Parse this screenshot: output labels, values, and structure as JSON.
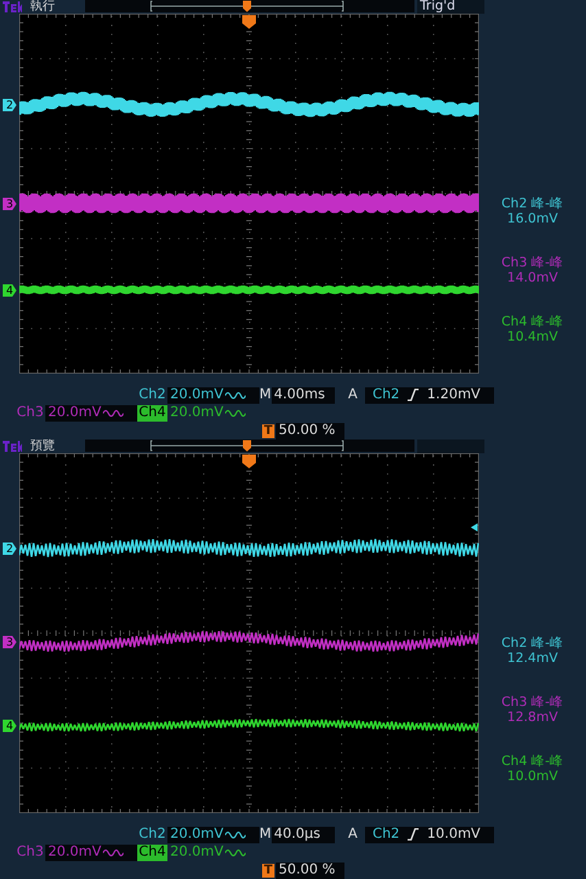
{
  "panels": [
    {
      "status": "執行",
      "trigger_state": "Trig'd",
      "trigger_level_marker": false,
      "channels": [
        {
          "label": "2",
          "color": "#3fd8e6"
        },
        {
          "label": "3",
          "color": "#c22fc4"
        },
        {
          "label": "4",
          "color": "#2fd62f"
        }
      ],
      "measurements": [
        {
          "label": "Ch2 峰-峰",
          "value": "16.0mV",
          "color": "#3fc4d2"
        },
        {
          "label": "Ch3 峰-峰",
          "value": "14.0mV",
          "color": "#b02cb8"
        },
        {
          "label": "Ch4 峰-峰",
          "value": "10.4mV",
          "color": "#2cbc2c"
        }
      ],
      "vertical": [
        {
          "channel": "Ch2",
          "scale": "20.0mV",
          "selected": false,
          "color": "#3fc4d2"
        },
        {
          "channel": "Ch3",
          "scale": "20.0mV",
          "selected": false,
          "color": "#b02cb8"
        },
        {
          "channel": "Ch4",
          "scale": "20.0mV",
          "selected": true,
          "color": "#2cbc2c"
        }
      ],
      "timebase": {
        "prefix": "M",
        "value": "4.00ms"
      },
      "trigger": {
        "mode": "A",
        "source": "Ch2",
        "value": "1.20mV"
      },
      "trigger_position": {
        "icon": "T",
        "value": "50.00 %"
      }
    },
    {
      "status": "預覽",
      "trigger_level_marker": true,
      "channels": [
        {
          "label": "2",
          "color": "#3fd8e6"
        },
        {
          "label": "3",
          "color": "#c22fc4"
        },
        {
          "label": "4",
          "color": "#2fd62f"
        }
      ],
      "measurements": [
        {
          "label": "Ch2 峰-峰",
          "value": "12.4mV",
          "color": "#3fc4d2"
        },
        {
          "label": "Ch3 峰-峰",
          "value": "12.8mV",
          "color": "#b02cb8"
        },
        {
          "label": "Ch4 峰-峰",
          "value": "10.0mV",
          "color": "#2cbc2c"
        }
      ],
      "vertical": [
        {
          "channel": "Ch2",
          "scale": "20.0mV",
          "selected": false,
          "color": "#3fc4d2"
        },
        {
          "channel": "Ch3",
          "scale": "20.0mV",
          "selected": false,
          "color": "#b02cb8"
        },
        {
          "channel": "Ch4",
          "scale": "20.0mV",
          "selected": true,
          "color": "#2cbc2c"
        }
      ],
      "timebase": {
        "prefix": "M",
        "value": "40.0µs"
      },
      "trigger": {
        "mode": "A",
        "source": "Ch2",
        "value": "10.0mV"
      },
      "trigger_position": {
        "icon": "T",
        "value": "50.00 %"
      }
    }
  ]
}
